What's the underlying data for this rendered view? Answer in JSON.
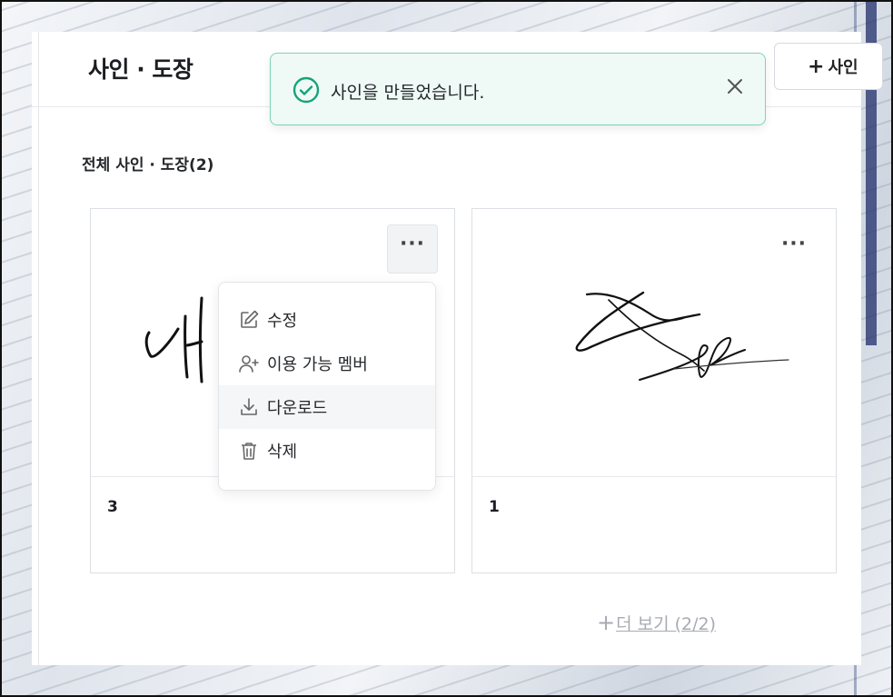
{
  "header": {
    "title": "사인 · 도장",
    "add_button_label": "사인"
  },
  "toast": {
    "message": "사인을 만들었습니다.",
    "accent": "#16a37a"
  },
  "section": {
    "title": "전체 사인 · 도장(2)"
  },
  "cards": [
    {
      "name": "3"
    },
    {
      "name": "1"
    }
  ],
  "context_menu": {
    "items": [
      {
        "label": "수정",
        "icon": "edit-icon"
      },
      {
        "label": "이용 가능 멤버",
        "icon": "add-user-icon"
      },
      {
        "label": "다운로드",
        "icon": "download-icon"
      },
      {
        "label": "삭제",
        "icon": "trash-icon"
      }
    ]
  },
  "load_more": {
    "label": "더 보기 (2/2)"
  }
}
